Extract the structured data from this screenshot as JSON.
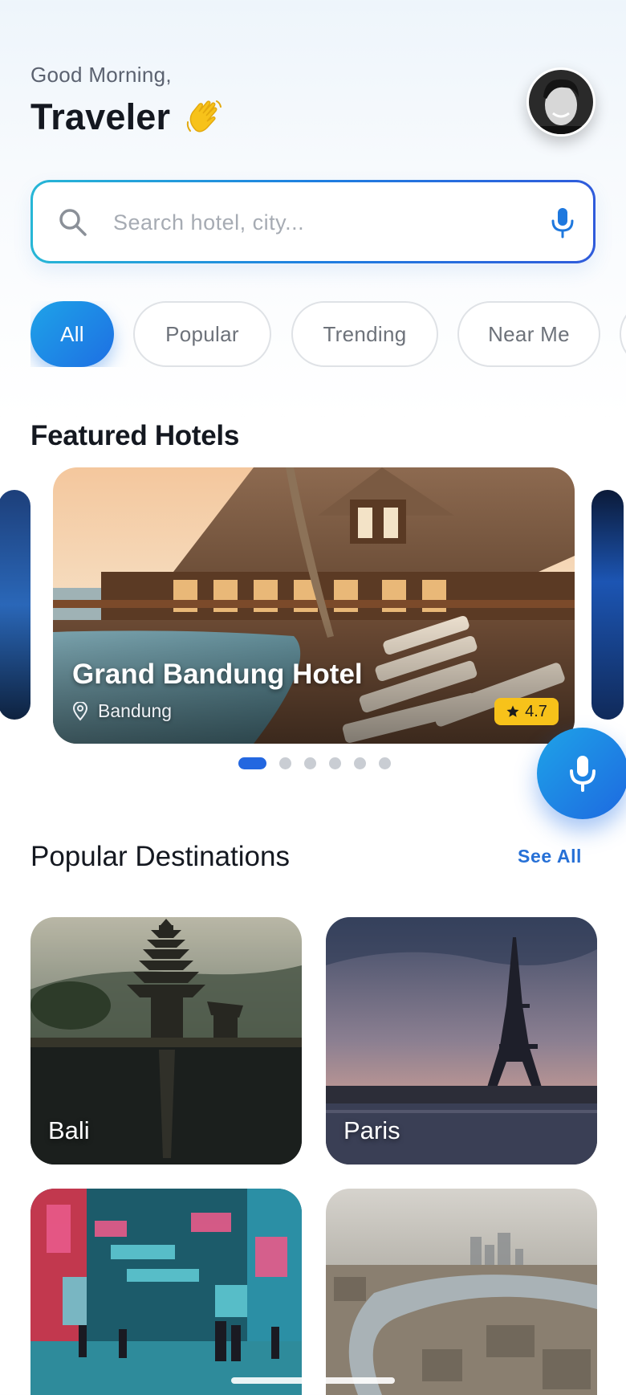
{
  "header": {
    "greeting": "Good Morning,",
    "name": "Traveler"
  },
  "search": {
    "placeholder": "Search hotel, city..."
  },
  "filters": [
    "All",
    "Popular",
    "Trending",
    "Near Me"
  ],
  "featured": {
    "title": "Featured Hotels",
    "hotel_name": "Grand Bandung Hotel",
    "location": "Bandung",
    "rating": "4.7"
  },
  "carousel": {
    "page_count": 6,
    "active_page": 1
  },
  "popular": {
    "title": "Popular Destinations",
    "see_all": "See All",
    "destinations": [
      "Bali",
      "Paris"
    ]
  },
  "colors": {
    "accent": "#1f75e2",
    "rating_badge": "#f7c21a"
  },
  "icons": [
    "wave-icon",
    "search-icon",
    "mic-icon",
    "location-pin-icon",
    "star-icon"
  ]
}
